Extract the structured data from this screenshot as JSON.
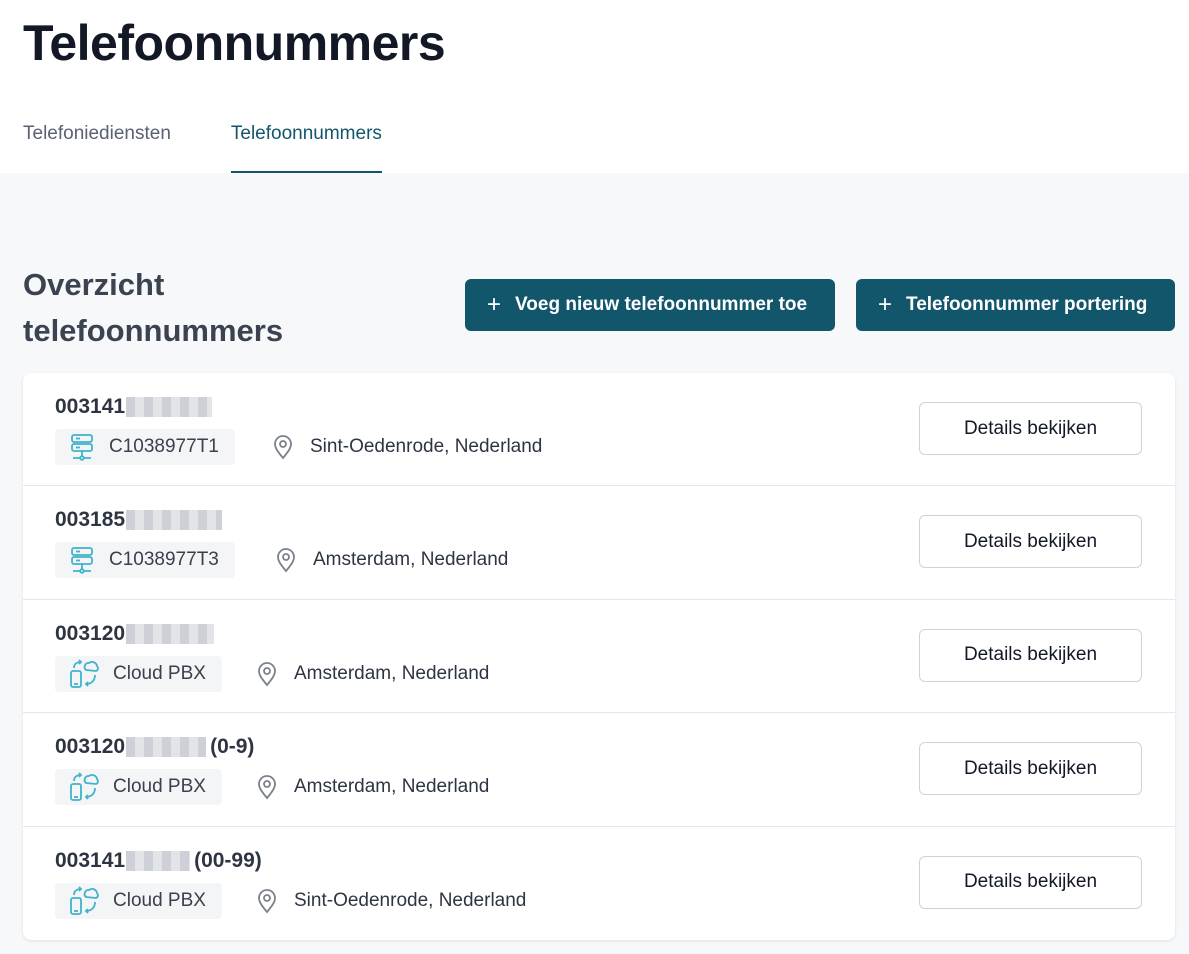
{
  "page": {
    "title": "Telefoonnummers"
  },
  "tabs": [
    {
      "label": "Telefoniediensten",
      "active": false
    },
    {
      "label": "Telefoonnummers",
      "active": true
    }
  ],
  "section": {
    "title": "Overzicht telefoonnummers",
    "add_button": "Voeg nieuw telefoonnummer toe",
    "port_button": "Telefoonnummer portering",
    "plus_icon": "+"
  },
  "colors": {
    "primary": "#12566b",
    "icon_teal": "#3fb3c9"
  },
  "rows": [
    {
      "prefix": "003141",
      "suffix": "",
      "service_icon": "server-icon",
      "service": "C1038977T1",
      "location": "Sint-Oedenrode, Nederland",
      "action": "Details bekijken"
    },
    {
      "prefix": "003185",
      "suffix": "",
      "service_icon": "server-icon",
      "service": "C1038977T3",
      "location": "Amsterdam, Nederland",
      "action": "Details bekijken"
    },
    {
      "prefix": "003120",
      "suffix": "",
      "service_icon": "cloud-pbx-icon",
      "service": "Cloud PBX",
      "location": "Amsterdam, Nederland",
      "action": "Details bekijken"
    },
    {
      "prefix": "003120",
      "suffix": "(0-9)",
      "service_icon": "cloud-pbx-icon",
      "service": "Cloud PBX",
      "location": "Amsterdam, Nederland",
      "action": "Details bekijken"
    },
    {
      "prefix": "003141",
      "suffix": "(00-99)",
      "service_icon": "cloud-pbx-icon",
      "service": "Cloud PBX",
      "location": "Sint-Oedenrode, Nederland",
      "action": "Details bekijken"
    }
  ]
}
